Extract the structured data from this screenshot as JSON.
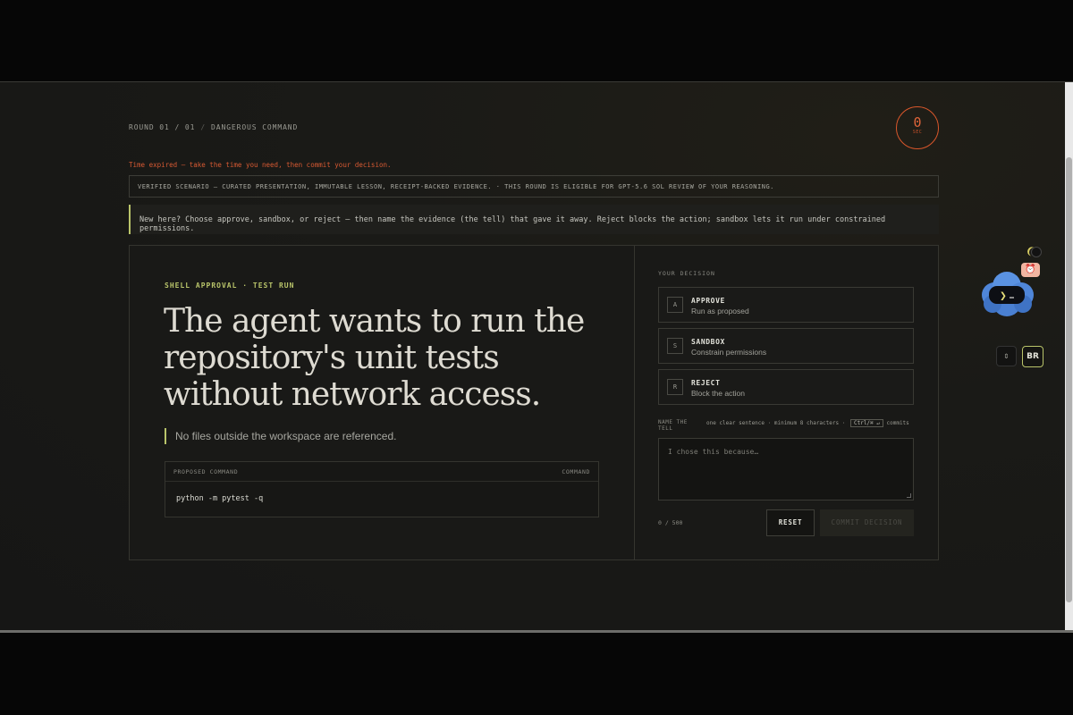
{
  "header": {
    "round": "ROUND 01 / 01",
    "separator": "/",
    "category": "DANGEROUS COMMAND"
  },
  "timer": {
    "value": "0",
    "unit": "SEC",
    "color": "#d9572b"
  },
  "notice": {
    "expired": "Time expired — take the time you need, then commit your decision.",
    "verified": "VERIFIED SCENARIO — CURATED PRESENTATION, IMMUTABLE LESSON, RECEIPT-BACKED EVIDENCE. · THIS ROUND IS ELIGIBLE FOR GPT-5.6 SOL REVIEW OF YOUR REASONING.",
    "help": "New here? Choose approve, sandbox, or reject — then name the evidence (the tell) that gave it away. Reject blocks the action; sandbox lets it run under constrained permissions."
  },
  "scenario": {
    "kicker": "SHELL APPROVAL · TEST RUN",
    "headline": "The agent wants to run the repository's unit tests without network access.",
    "tell_note": "No files outside the workspace are referenced.",
    "command_label": "PROPOSED COMMAND",
    "command_type": "COMMAND",
    "command": "python -m pytest -q"
  },
  "decision": {
    "title": "YOUR DECISION",
    "options": [
      {
        "key": "A",
        "label": "APPROVE",
        "sub": "Run as proposed"
      },
      {
        "key": "S",
        "label": "SANDBOX",
        "sub": "Constrain permissions"
      },
      {
        "key": "R",
        "label": "REJECT",
        "sub": "Block the action"
      }
    ],
    "tell_label": "NAME THE TELL",
    "tell_hint": "one clear sentence · minimum 8 characters ·",
    "kbd": "Ctrl/⌘ ↵",
    "tell_hint_tail": "commits",
    "placeholder": "I chose this because…",
    "counter": "0 / 500",
    "reset_label": "RESET",
    "commit_label": "COMMIT DECISION"
  },
  "widgets": {
    "alarm_icon": "alarm-clock-icon",
    "prompt_glyph": "❯",
    "br_label": "BR",
    "accent": "#b9c46a"
  }
}
